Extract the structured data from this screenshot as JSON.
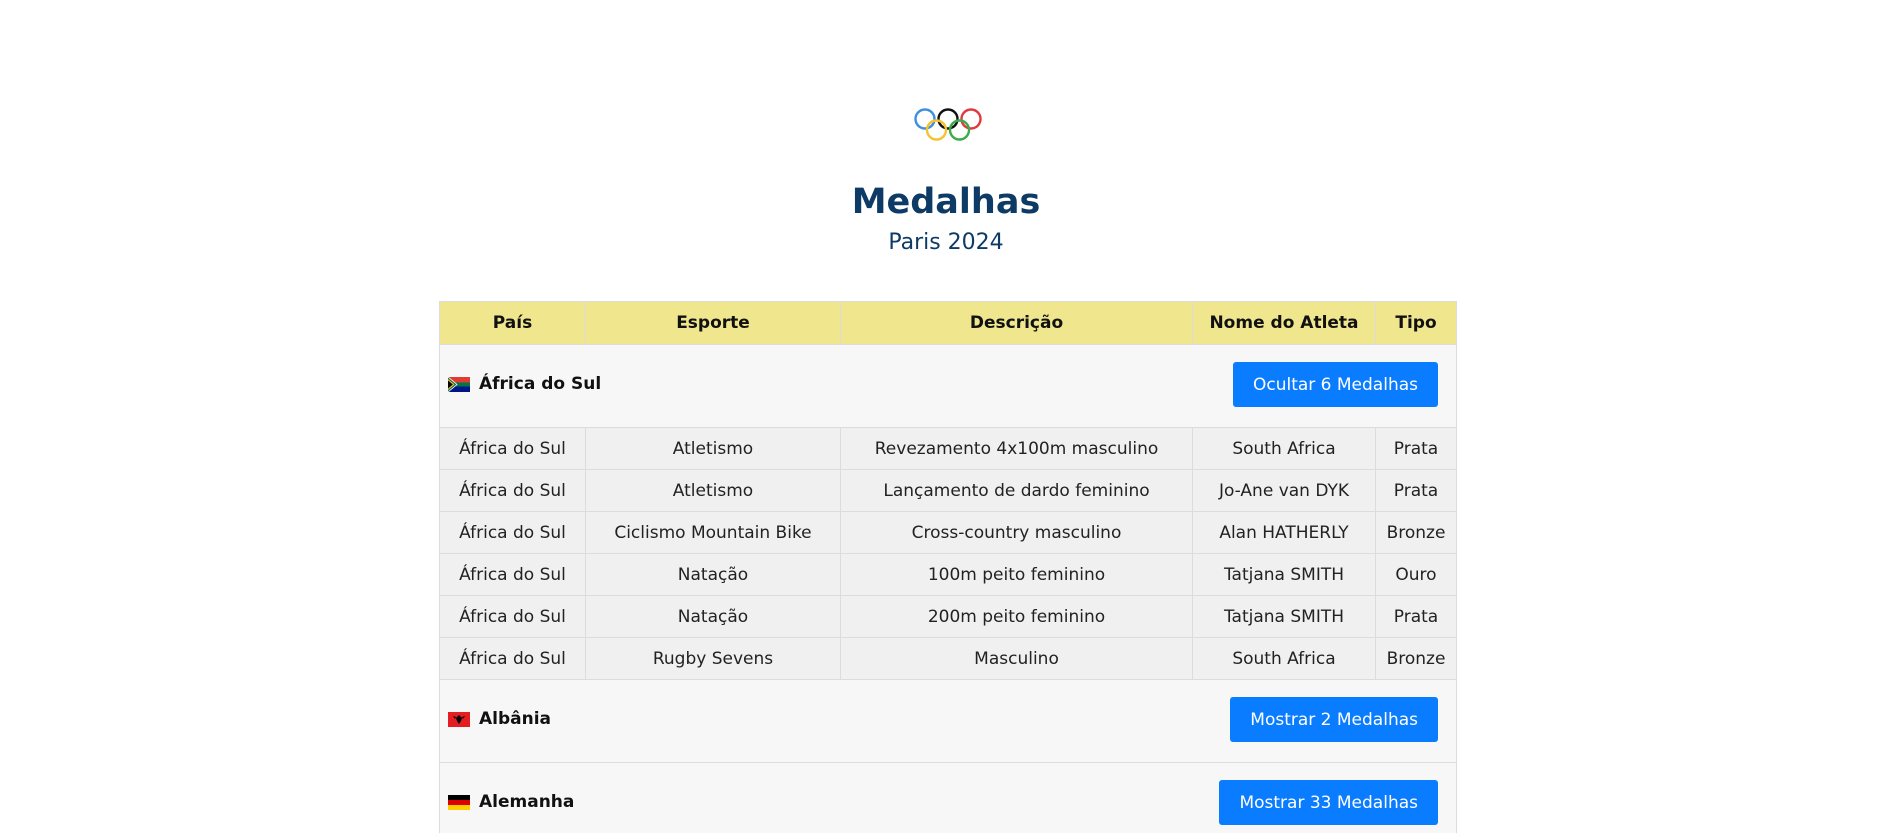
{
  "header": {
    "title": "Medalhas",
    "subtitle": "Paris 2024",
    "logo_icon": "olympic-rings-icon"
  },
  "table": {
    "columns": [
      "País",
      "Esporte",
      "Descrição",
      "Nome do Atleta",
      "Tipo"
    ]
  },
  "groups": [
    {
      "country": "África do Sul",
      "flag_icon": "south-africa-flag-icon",
      "button_label": "Ocultar 6 Medalhas",
      "expanded": true,
      "rows": [
        [
          "África do Sul",
          "Atletismo",
          "Revezamento 4x100m masculino",
          "South Africa",
          "Prata"
        ],
        [
          "África do Sul",
          "Atletismo",
          "Lançamento de dardo feminino",
          "Jo-Ane van DYK",
          "Prata"
        ],
        [
          "África do Sul",
          "Ciclismo Mountain Bike",
          "Cross-country masculino",
          "Alan HATHERLY",
          "Bronze"
        ],
        [
          "África do Sul",
          "Natação",
          "100m peito feminino",
          "Tatjana SMITH",
          "Ouro"
        ],
        [
          "África do Sul",
          "Natação",
          "200m peito feminino",
          "Tatjana SMITH",
          "Prata"
        ],
        [
          "África do Sul",
          "Rugby Sevens",
          "Masculino",
          "South Africa",
          "Bronze"
        ]
      ]
    },
    {
      "country": "Albânia",
      "flag_icon": "albania-flag-icon",
      "button_label": "Mostrar 2 Medalhas",
      "expanded": false,
      "rows": []
    },
    {
      "country": "Alemanha",
      "flag_icon": "germany-flag-icon",
      "button_label": "Mostrar 33 Medalhas",
      "expanded": false,
      "rows": []
    }
  ],
  "colors": {
    "header_bg": "#efe68e",
    "title": "#0e3a66",
    "button": "#0a7cff"
  }
}
